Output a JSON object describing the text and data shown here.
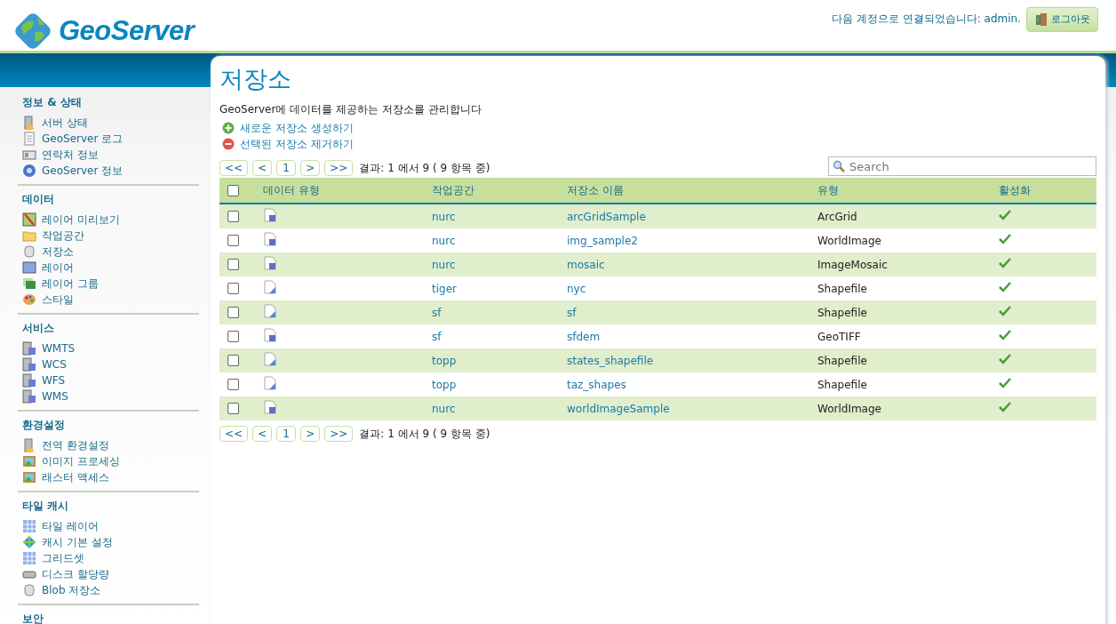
{
  "header": {
    "logo": "GeoServer",
    "login_text": "다음 계정으로 연결되었습니다: admin.",
    "logout_button": "로그아웃"
  },
  "sidebar": [
    {
      "title": "정보 & 상태",
      "items": [
        {
          "label": "서버 상태",
          "kind": "server"
        },
        {
          "label": "GeoServer 로그",
          "kind": "document"
        },
        {
          "label": "연락처 정보",
          "kind": "card"
        },
        {
          "label": "GeoServer 정보",
          "kind": "help"
        }
      ]
    },
    {
      "title": "데이터",
      "items": [
        {
          "label": "레이어 미리보기",
          "kind": "map"
        },
        {
          "label": "작업공간",
          "kind": "folder"
        },
        {
          "label": "저장소",
          "kind": "database"
        },
        {
          "label": "레이어",
          "kind": "layer"
        },
        {
          "label": "레이어 그룹",
          "kind": "layers"
        },
        {
          "label": "스타일",
          "kind": "palette"
        }
      ]
    },
    {
      "title": "서비스",
      "items": [
        {
          "label": "WMTS",
          "kind": "service"
        },
        {
          "label": "WCS",
          "kind": "service"
        },
        {
          "label": "WFS",
          "kind": "service"
        },
        {
          "label": "WMS",
          "kind": "service"
        }
      ]
    },
    {
      "title": "환경설정",
      "items": [
        {
          "label": "전역 환경설정",
          "kind": "server"
        },
        {
          "label": "이미지 프로세싱",
          "kind": "image"
        },
        {
          "label": "래스터 액세스",
          "kind": "image"
        }
      ]
    },
    {
      "title": "타일 캐시",
      "items": [
        {
          "label": "타일 레이어",
          "kind": "grid"
        },
        {
          "label": "캐시 기본 설정",
          "kind": "globe"
        },
        {
          "label": "그리드셋",
          "kind": "grid"
        },
        {
          "label": "디스크 할당량",
          "kind": "disk"
        },
        {
          "label": "Blob 저장소",
          "kind": "database"
        }
      ]
    },
    {
      "title": "보안"
    }
  ],
  "page": {
    "title": "저장소",
    "description": "GeoServer에 데이터를 제공하는 저장소를 관리합니다",
    "actions": [
      {
        "label": "새로운 저장소 생성하기",
        "kind": "add"
      },
      {
        "label": "선택된 저장소 제거하기",
        "kind": "remove"
      }
    ]
  },
  "pager_top": {
    "buttons": [
      "<<",
      "<",
      "1",
      ">",
      ">>"
    ],
    "summary": "결과: 1 에서 9 ( 9 항목 중)"
  },
  "search": {
    "placeholder": "Search"
  },
  "table": {
    "select_all_checked": false,
    "columns": [
      "데이터 유형",
      "작업공간",
      "저장소 이름",
      "유형",
      "활성화"
    ],
    "rows": [
      {
        "checked": false,
        "kind": "raster",
        "workspace": "nurc",
        "name": "arcGridSample",
        "type": "ArcGrid",
        "enabled": true
      },
      {
        "checked": false,
        "kind": "raster",
        "workspace": "nurc",
        "name": "img_sample2",
        "type": "WorldImage",
        "enabled": true
      },
      {
        "checked": false,
        "kind": "raster",
        "workspace": "nurc",
        "name": "mosaic",
        "type": "ImageMosaic",
        "enabled": true
      },
      {
        "checked": false,
        "kind": "vector",
        "workspace": "tiger",
        "name": "nyc",
        "type": "Shapefile",
        "enabled": true
      },
      {
        "checked": false,
        "kind": "vector",
        "workspace": "sf",
        "name": "sf",
        "type": "Shapefile",
        "enabled": true
      },
      {
        "checked": false,
        "kind": "raster",
        "workspace": "sf",
        "name": "sfdem",
        "type": "GeoTIFF",
        "enabled": true
      },
      {
        "checked": false,
        "kind": "vector",
        "workspace": "topp",
        "name": "states_shapefile",
        "type": "Shapefile",
        "enabled": true
      },
      {
        "checked": false,
        "kind": "vector",
        "workspace": "topp",
        "name": "taz_shapes",
        "type": "Shapefile",
        "enabled": true
      },
      {
        "checked": false,
        "kind": "raster",
        "workspace": "nurc",
        "name": "worldImageSample",
        "type": "WorldImage",
        "enabled": true
      }
    ]
  },
  "pager_bottom": {
    "buttons": [
      "<<",
      "<",
      "1",
      ">",
      ">>"
    ],
    "summary": "결과: 1 에서 9 ( 9 항목 중)"
  }
}
